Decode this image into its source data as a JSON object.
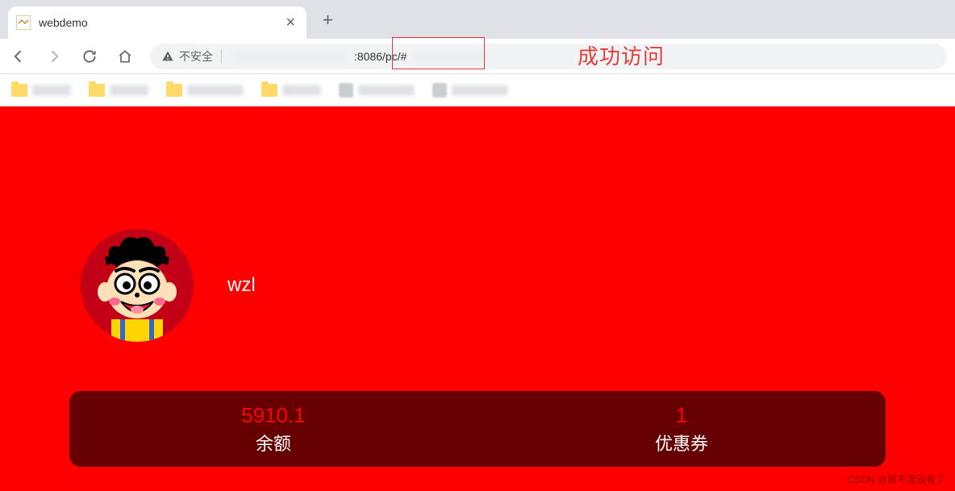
{
  "browser": {
    "tab_title": "webdemo",
    "security_label": "不安全",
    "url_visible": ":8086/pc/#"
  },
  "annotation": {
    "text": "成功访问"
  },
  "profile": {
    "username": "wzl"
  },
  "stats": {
    "balance": {
      "value": "5910.1",
      "label": "余额"
    },
    "coupon": {
      "value": "1",
      "label": "优惠券"
    }
  },
  "watermark": "CSDN @尿不湿没有了"
}
